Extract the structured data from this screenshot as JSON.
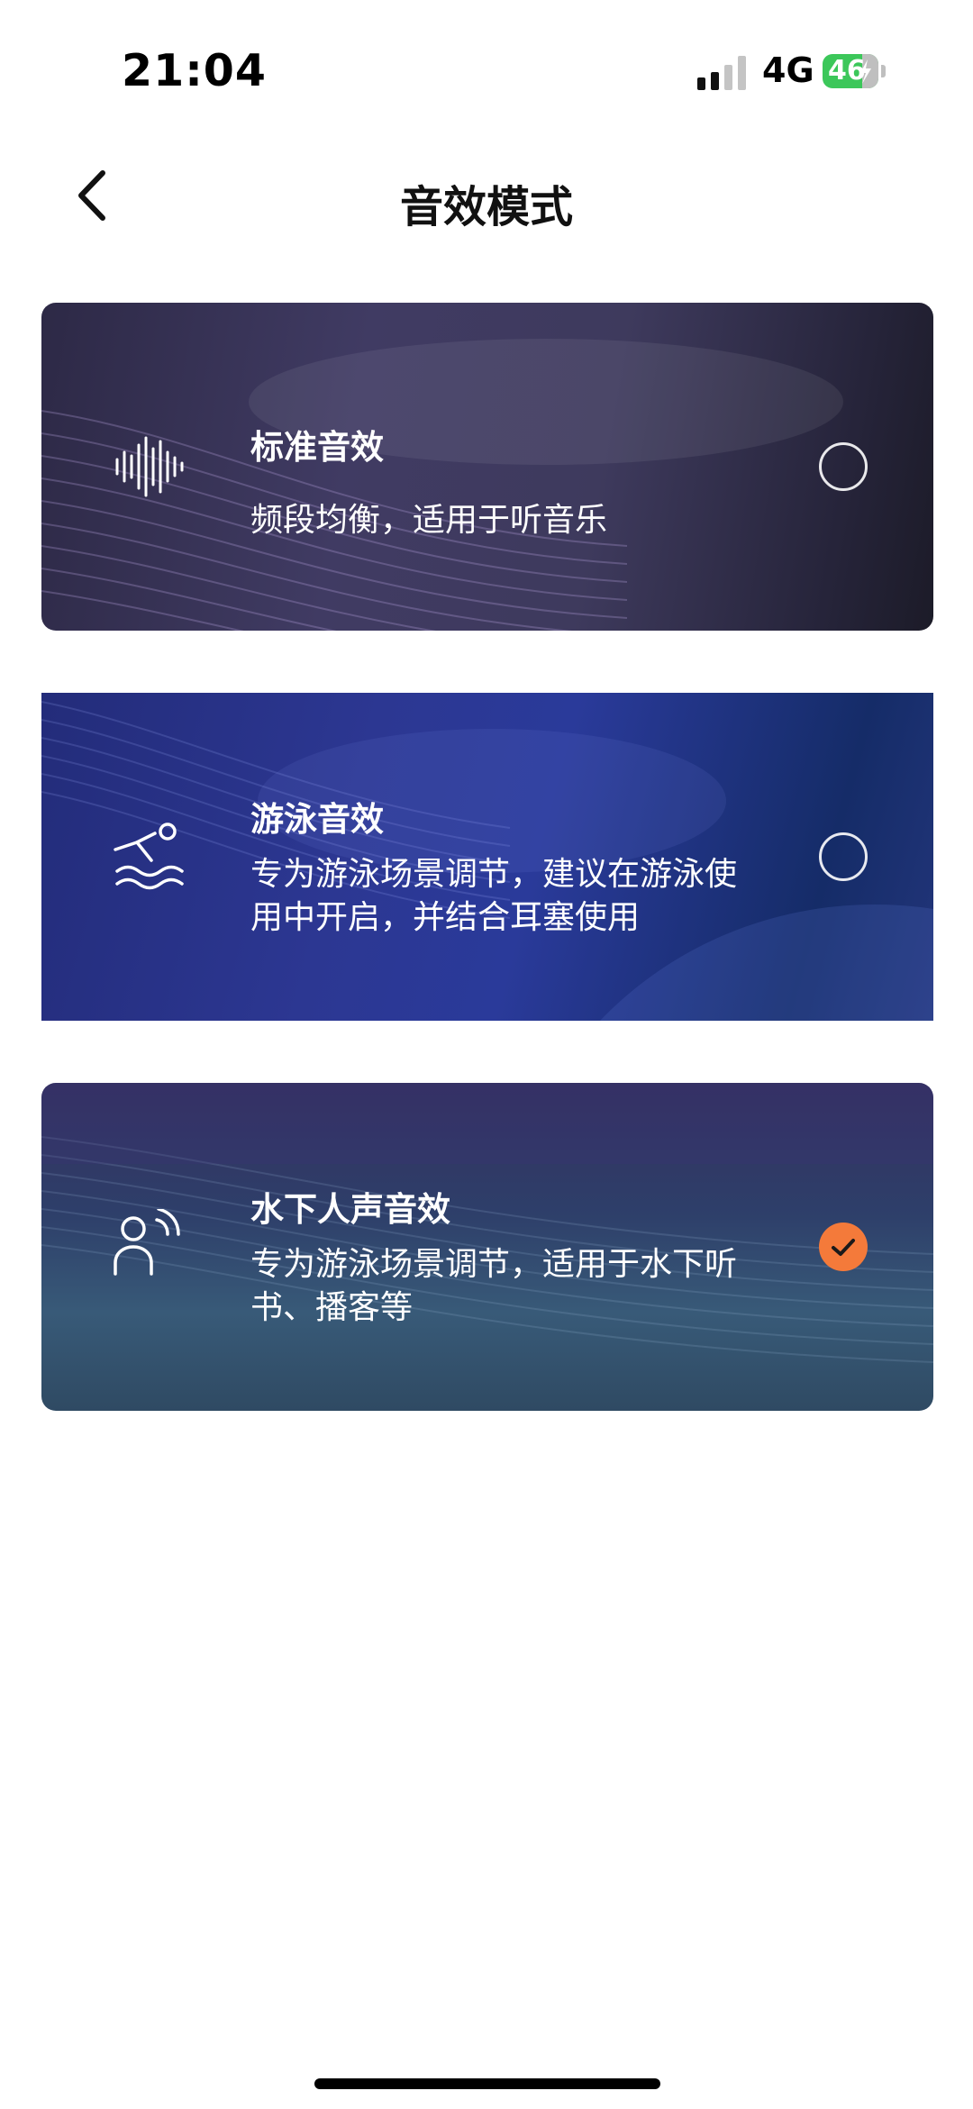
{
  "status_bar": {
    "time": "21:04",
    "network": "4G",
    "battery": "46",
    "signal_bars": 4,
    "signal_active_bars": 2
  },
  "nav": {
    "title": "音效模式",
    "back_icon": "chevron-left-icon"
  },
  "colors": {
    "accent_orange": "#f47a3a",
    "battery_green": "#3cc75a"
  },
  "sound_modes": [
    {
      "title": "标准音效",
      "description": "频段均衡，适用于听音乐",
      "icon": "sound-wave-icon",
      "selected": false
    },
    {
      "title": "游泳音效",
      "description": "专为游泳场景调节，建议在游泳使用中开启，并结合耳塞使用",
      "icon": "swimmer-icon",
      "selected": false
    },
    {
      "title": "水下人声音效",
      "description": "专为游泳场景调节，适用于水下听书、播客等",
      "icon": "person-voice-icon",
      "selected": true
    }
  ]
}
